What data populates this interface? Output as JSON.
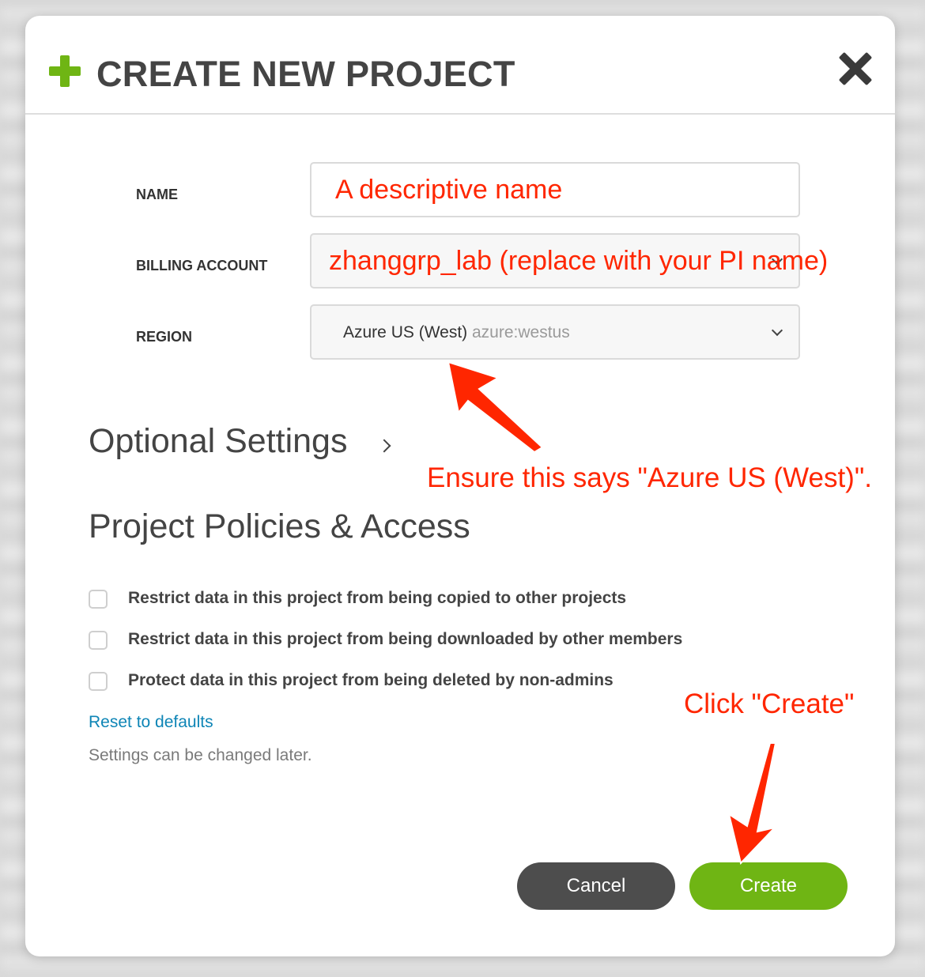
{
  "dialog": {
    "title": "CREATE NEW PROJECT"
  },
  "form": {
    "name_label": "NAME",
    "name_value": "A descriptive name",
    "billing_label": "BILLING ACCOUNT",
    "billing_value": "zhanggrp_lab (replace with your PI name)",
    "region_label": "REGION",
    "region_value": "Azure US (West)",
    "region_id": "azure:westus"
  },
  "sections": {
    "optional_settings": "Optional Settings",
    "policies": "Project Policies & Access"
  },
  "policies": [
    {
      "label": "Restrict data in this project from being copied to other projects",
      "checked": false
    },
    {
      "label": "Restrict data in this project from being downloaded by other members",
      "checked": false
    },
    {
      "label": "Protect data in this project from being deleted by non-admins",
      "checked": false
    }
  ],
  "reset_link": "Reset to defaults",
  "note": "Settings can be changed later.",
  "buttons": {
    "cancel": "Cancel",
    "create": "Create"
  },
  "annotations": {
    "region_hint": "Ensure this says \"Azure US (West)\".",
    "create_hint": "Click \"Create\""
  },
  "colors": {
    "accent_green": "#6fb514",
    "annotation_red": "#ff2600",
    "link_blue": "#0e85b6",
    "cancel_gray": "#4d4d4d"
  }
}
